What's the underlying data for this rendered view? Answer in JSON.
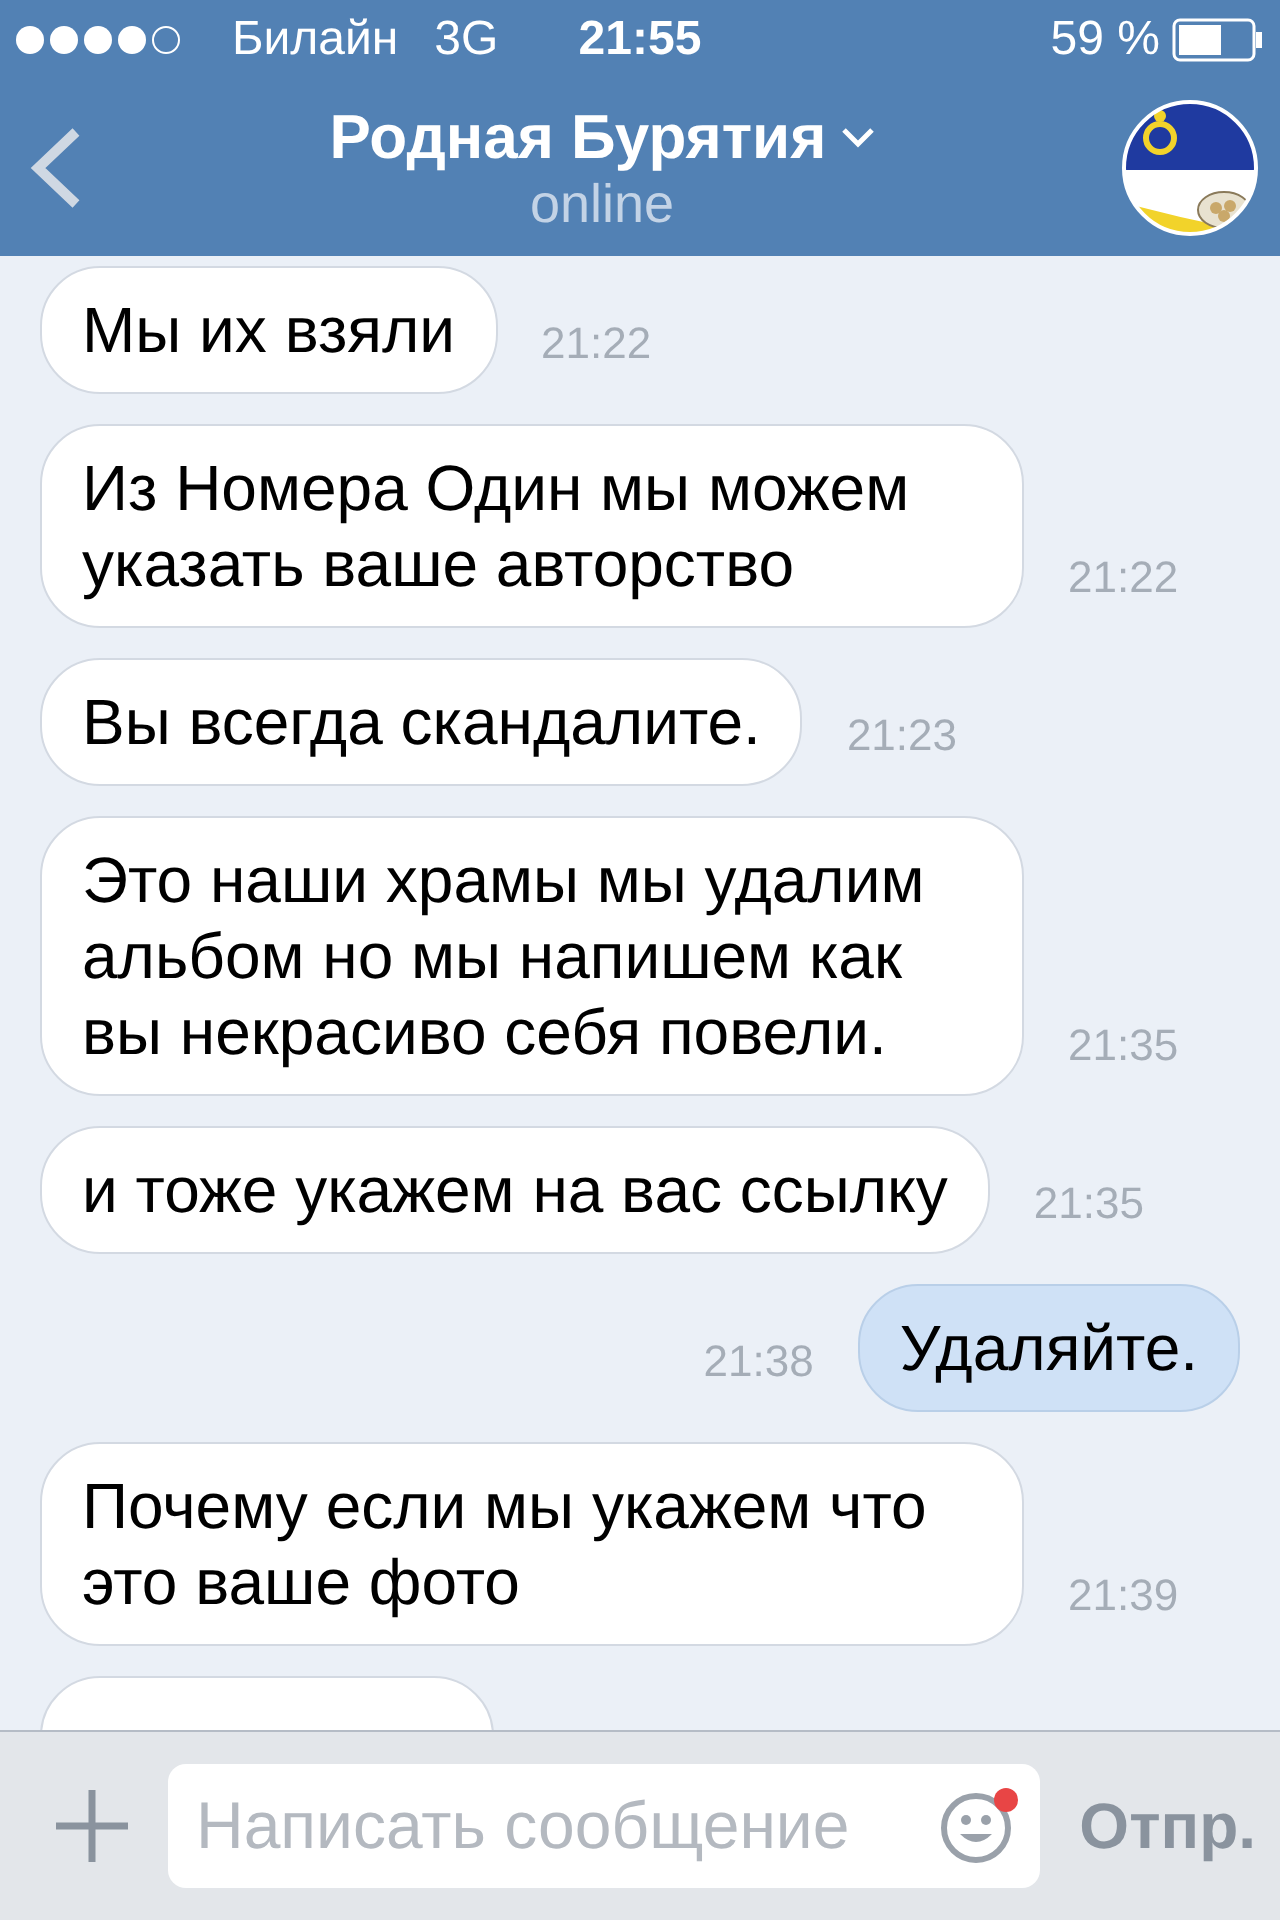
{
  "status_bar": {
    "carrier": "Билайн",
    "network": "3G",
    "time": "21:55",
    "battery": "59 %"
  },
  "header": {
    "title": "Родная Бурятия",
    "subtitle": "online"
  },
  "messages": [
    {
      "kind": "incoming",
      "text": "Мы их взяли",
      "time": "21:22"
    },
    {
      "kind": "incoming",
      "text": "Из Номера Один мы можем указать ваше авторство",
      "time": "21:22"
    },
    {
      "kind": "incoming",
      "text": "Вы всегда скандалите.",
      "time": "21:23"
    },
    {
      "kind": "incoming",
      "text": "Это наши храмы мы удалим альбом но мы напишем как вы некрасиво себя повели.",
      "time": "21:35"
    },
    {
      "kind": "incoming",
      "text": "и тоже укажем на вас ссылку",
      "time": "21:35"
    },
    {
      "kind": "outgoing",
      "text": "Удаляйте.",
      "time": "21:38"
    },
    {
      "kind": "incoming",
      "text": "Почему если мы укажем что это ваше фото",
      "time": "21:39"
    },
    {
      "kind": "cut"
    }
  ],
  "composer": {
    "placeholder": "Написать сообщение",
    "send": "Отпр."
  }
}
